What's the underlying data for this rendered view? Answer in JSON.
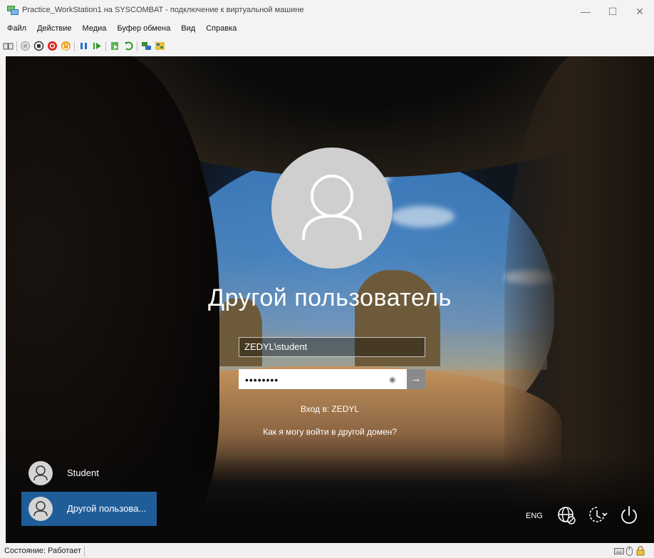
{
  "window": {
    "title": "Practice_WorkStation1 на SYSCOMBAT - подключение к виртуальной машине",
    "minimize_glyph": "—",
    "maximize_glyph": "☐",
    "close_glyph": "✕"
  },
  "menu": [
    "Файл",
    "Действие",
    "Медиа",
    "Буфер обмена",
    "Вид",
    "Справка"
  ],
  "toolbar_icons": [
    "ctrl-alt-del-icon",
    "start-icon",
    "turn-off-icon",
    "shut-down-icon",
    "reset-icon",
    "pause-icon",
    "resume-icon",
    "checkpoint-icon",
    "revert-icon",
    "enhanced-session-icon",
    "share-icon"
  ],
  "login": {
    "display_name": "Другой пользователь",
    "username_value": "ZEDYL\\student",
    "password_value": "••••••••",
    "submit_glyph": "→",
    "eye_glyph": "◉",
    "sign_in_to": "Вход в: ZEDYL",
    "other_domain_link": "Как я могу войти в другой домен?"
  },
  "users": [
    {
      "name": "Student"
    },
    {
      "name": "Другой пользова..."
    }
  ],
  "system": {
    "language": "ENG"
  },
  "status": {
    "text": "Состояние: Работает"
  },
  "colors": {
    "selected_tile": "#1f5d99",
    "avatar": "#cfcfcf",
    "submit_button": "#8a8a8a"
  }
}
